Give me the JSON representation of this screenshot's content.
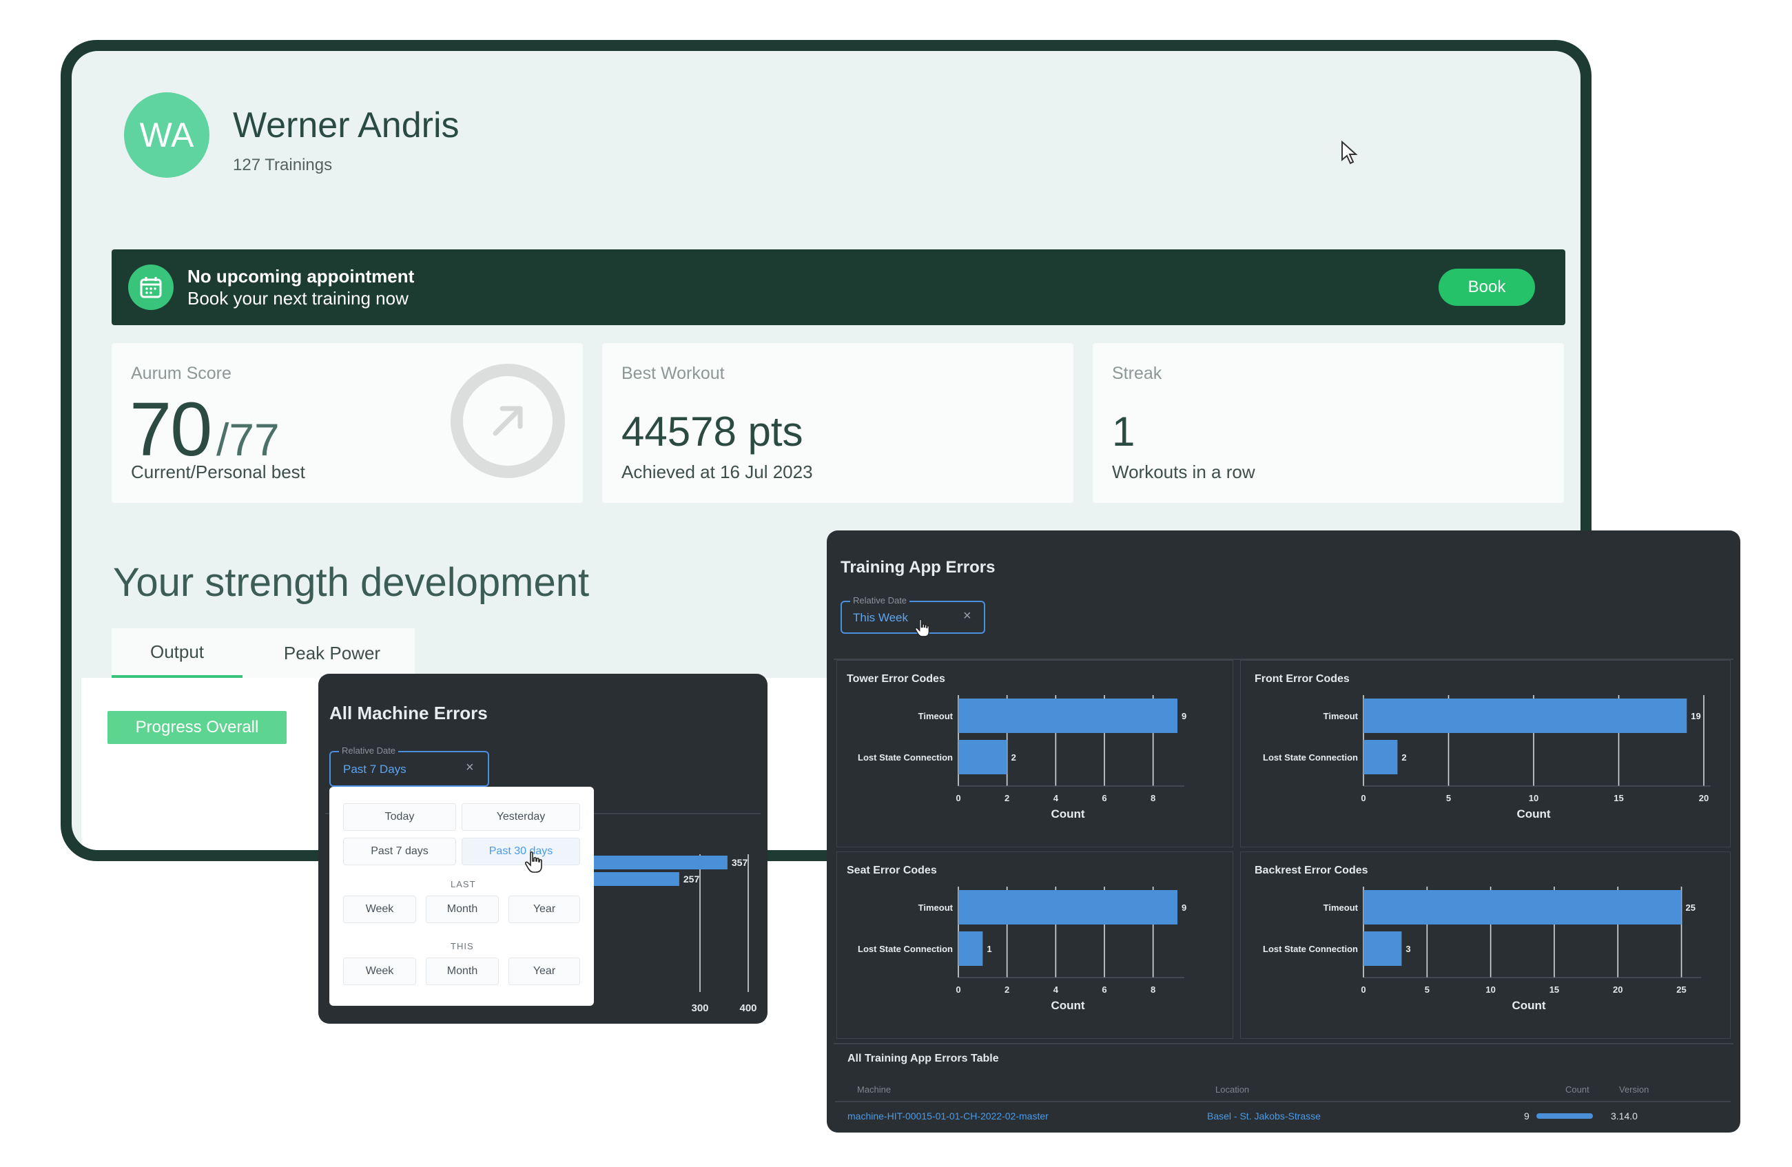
{
  "profile": {
    "initials": "WA",
    "name": "Werner Andris",
    "trainings": "127 Trainings"
  },
  "banner": {
    "title": "No upcoming appointment",
    "subtitle": "Book your next training now",
    "button_label": "Book"
  },
  "stats": {
    "aurum": {
      "label": "Aurum Score",
      "current": "70",
      "best": "/77",
      "sub": "Current/Personal best"
    },
    "best_workout": {
      "label": "Best Workout",
      "value": "44578 pts",
      "sub": "Achieved at 16 Jul 2023"
    },
    "streak": {
      "label": "Streak",
      "value": "1",
      "sub": "Workouts in a row"
    }
  },
  "strength": {
    "title": "Your strength development",
    "tabs": [
      "Output",
      "Peak Power"
    ],
    "active_tab": "Output",
    "progress_button": "Progress Overall"
  },
  "machine_errors": {
    "title": "All Machine Errors",
    "filter_label": "Relative Date",
    "filter_value": "Past 7 Days",
    "dropdown": {
      "row1": [
        "Today",
        "Yesterday"
      ],
      "row2": [
        "Past 7 days",
        "Past 30 days"
      ],
      "last_label": "LAST",
      "last": [
        "Week",
        "Month",
        "Year"
      ],
      "this_label": "THIS",
      "this": [
        "Week",
        "Month",
        "Year"
      ],
      "selected": "Past 30 days"
    },
    "chart_data": {
      "type": "bar",
      "orientation": "horizontal",
      "values": [
        357,
        257
      ],
      "x_ticks": [
        "300",
        "400"
      ]
    }
  },
  "training_errors": {
    "title": "Training App Errors",
    "filter_label": "Relative Date",
    "filter_value": "This Week",
    "colors": {
      "bar": "#4a90d9",
      "panel": "#2a2f34",
      "link": "#4a9be8"
    },
    "chart_data": [
      {
        "type": "bar",
        "orientation": "horizontal",
        "title": "Tower Error Codes",
        "categories": [
          "Timeout",
          "Lost State Connection"
        ],
        "values": [
          9,
          2
        ],
        "xlabel": "Count",
        "xlim": [
          0,
          9
        ],
        "x_ticks": [
          0,
          2,
          4,
          6,
          8
        ]
      },
      {
        "type": "bar",
        "orientation": "horizontal",
        "title": "Front Error Codes",
        "categories": [
          "Timeout",
          "Lost State Connection"
        ],
        "values": [
          19,
          2
        ],
        "xlabel": "Count",
        "xlim": [
          0,
          20
        ],
        "x_ticks": [
          0,
          5,
          10,
          15,
          20
        ]
      },
      {
        "type": "bar",
        "orientation": "horizontal",
        "title": "Seat Error Codes",
        "categories": [
          "Timeout",
          "Lost State Connection"
        ],
        "values": [
          9,
          1
        ],
        "xlabel": "Count",
        "xlim": [
          0,
          9
        ],
        "x_ticks": [
          0,
          2,
          4,
          6,
          8
        ]
      },
      {
        "type": "bar",
        "orientation": "horizontal",
        "title": "Backrest Error Codes",
        "categories": [
          "Timeout",
          "Lost State Connection"
        ],
        "values": [
          25,
          3
        ],
        "xlabel": "Count",
        "xlim": [
          0,
          26
        ],
        "x_ticks": [
          0,
          5,
          10,
          15,
          20,
          25
        ]
      }
    ],
    "table": {
      "title": "All Training App Errors Table",
      "columns": [
        "Machine",
        "Location",
        "Count",
        "Version"
      ],
      "rows": [
        {
          "machine": "machine-HIT-00015-01-01-CH-2022-02-master",
          "location": "Basel - St. Jakobs-Strasse",
          "count": "9",
          "count_fraction": 1.0,
          "version": "3.14.0"
        }
      ]
    }
  }
}
